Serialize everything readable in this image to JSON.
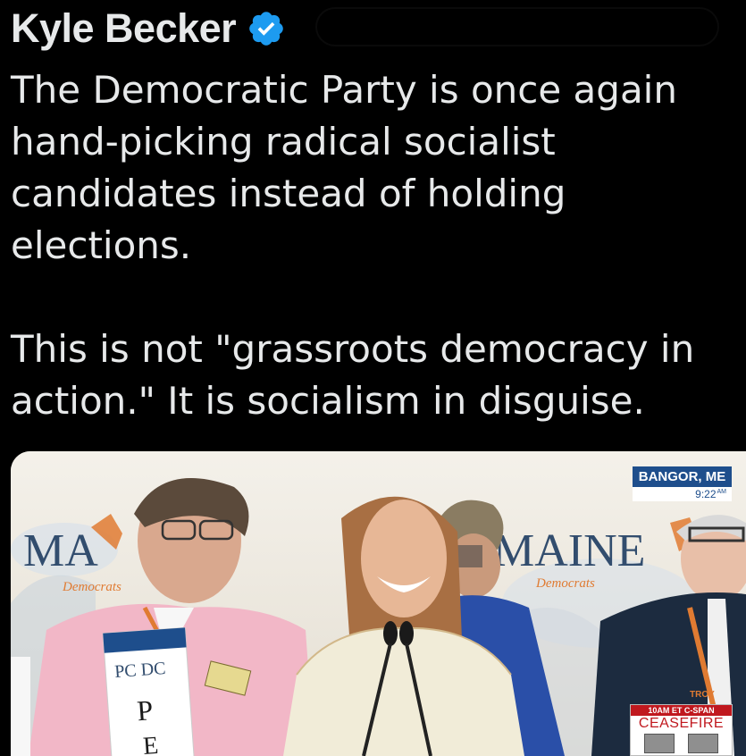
{
  "tweet": {
    "author_name": "Kyle Becker",
    "verified_icon": "verified-badge-icon",
    "handle_redacted": true,
    "paragraph1": "The Democratic Party is once again hand-picking radical socialist candidates instead of holding elections.",
    "paragraph2": "This is not \"grassroots democracy in action.\" It is socialism in disguise."
  },
  "media": {
    "location": "BANGOR, ME",
    "time": "9:22",
    "time_suffix": "AM",
    "backdrop_left": "MA",
    "backdrop_right": "MAINE",
    "backdrop_sub": "Democrats",
    "sign_text": "PC DC",
    "sign_letter1": "P",
    "sign_letter2": "E",
    "lanyard_text": "TROY",
    "promo_top": "10AM ET C-SPAN",
    "promo_title": "CEASEFIRE"
  },
  "colors": {
    "background": "#000000",
    "text": "#e7e9ea",
    "verified": "#1d9bf0",
    "cspan_blue": "#1e4e8c",
    "ceasefire_red": "#c0181e"
  }
}
